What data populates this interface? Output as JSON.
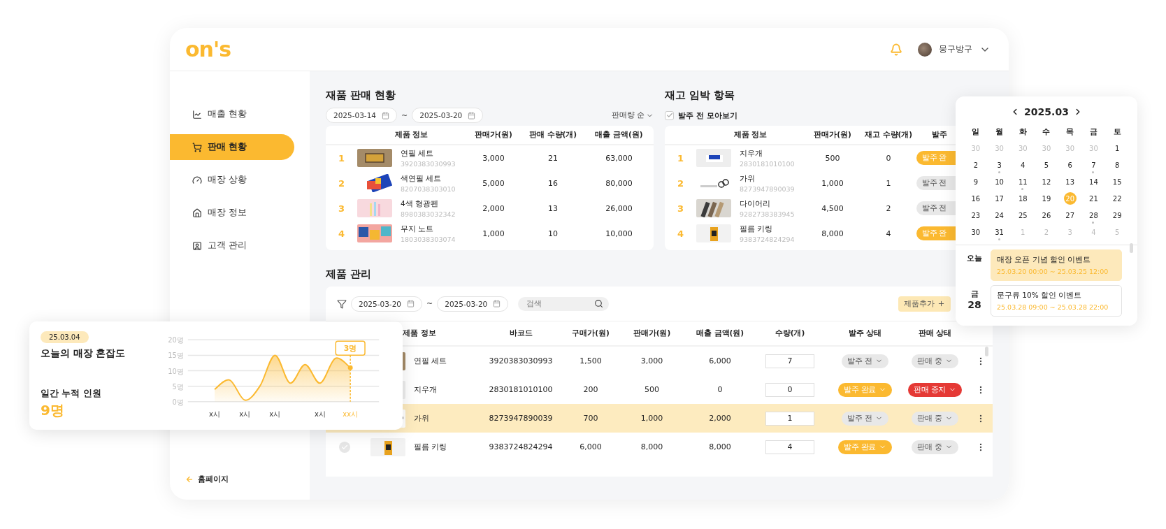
{
  "header": {
    "logo": "on's",
    "user_name": "뭉구방구"
  },
  "sidebar": {
    "items": [
      {
        "label": "매출 현황",
        "selected": false
      },
      {
        "label": "판매 현황",
        "selected": true
      },
      {
        "label": "매장 상황",
        "selected": false
      },
      {
        "label": "매장 정보",
        "selected": false
      },
      {
        "label": "고객 관리",
        "selected": false
      }
    ],
    "home_link": "홈페이지"
  },
  "sales": {
    "title": "재품 판매 현황",
    "date_from": "2025-03-14",
    "separator": "~",
    "date_to": "2025-03-20",
    "sort": "판매량 순",
    "columns": [
      "제품 정보",
      "판매가(원)",
      "판매 수량(개)",
      "매출 금액(원)"
    ],
    "rows": [
      {
        "rank": "1",
        "name": "연필 세트",
        "barcode": "3920383030993",
        "price": "3,000",
        "quantity": "21",
        "revenue": "63,000"
      },
      {
        "rank": "2",
        "name": "색연필 세트",
        "barcode": "8207038303010",
        "price": "5,000",
        "quantity": "16",
        "revenue": "80,000"
      },
      {
        "rank": "3",
        "name": "4색 형광펜",
        "barcode": "8980383032342",
        "price": "2,000",
        "quantity": "13",
        "revenue": "26,000"
      },
      {
        "rank": "4",
        "name": "무지 노트",
        "barcode": "1803038303074",
        "price": "1,000",
        "quantity": "10",
        "revenue": "10,000"
      }
    ]
  },
  "stock": {
    "title": "재고 임박 항목",
    "filter_label": "발주 전 모아보기",
    "filter_checked": true,
    "columns": [
      "제품 정보",
      "판매가(원)",
      "재고 수량(개)",
      "발주"
    ],
    "rows": [
      {
        "rank": "1",
        "name": "지우개",
        "barcode": "2830181010100",
        "price": "500",
        "stock": "0",
        "status": {
          "label": "발주 완",
          "color": "#fbb930"
        }
      },
      {
        "rank": "2",
        "name": "가위",
        "barcode": "8273947890039",
        "price": "1,000",
        "stock": "1",
        "status": {
          "label": "발주 전",
          "color": "#e8e8e8"
        }
      },
      {
        "rank": "3",
        "name": "다이어리",
        "barcode": "9282738383945",
        "price": "4,500",
        "stock": "2",
        "status": {
          "label": "발주 전",
          "color": "#e8e8e8"
        }
      },
      {
        "rank": "4",
        "name": "필름 키링",
        "barcode": "9383724824294",
        "price": "8,000",
        "stock": "4",
        "status": {
          "label": "발주 완",
          "color": "#fbb930"
        }
      }
    ]
  },
  "products": {
    "title": "제품 관리",
    "date_from": "2025-03-20",
    "separator": "~",
    "date_to": "2025-03-20",
    "search_placeholder": "검색",
    "add_button": "제품추가",
    "columns": [
      "제품 정보",
      "바코드",
      "구매가(원)",
      "판매가(원)",
      "매출 금액(원)",
      "수량(개)",
      "발주 상태",
      "판매 상태"
    ],
    "rows": [
      {
        "selected": false,
        "name": "연필 세트",
        "barcode": "3920383030993",
        "cost": "1,500",
        "price": "3,000",
        "revenue": "6,000",
        "quantity": "7",
        "order_status": {
          "label": "발주 전",
          "color": "#e8e8e8"
        },
        "sale_status": {
          "label": "판매 중",
          "color": "#e8e8e8"
        }
      },
      {
        "selected": false,
        "name": "지우개",
        "barcode": "2830181010100",
        "cost": "200",
        "price": "500",
        "revenue": "0",
        "quantity": "0",
        "order_status": {
          "label": "발주 완료",
          "color": "#fbb930"
        },
        "sale_status": {
          "label": "판매 중지",
          "color": "#e53935"
        }
      },
      {
        "selected": true,
        "name": "가위",
        "barcode": "8273947890039",
        "cost": "700",
        "price": "1,000",
        "revenue": "2,000",
        "quantity": "1",
        "order_status": {
          "label": "발주 전",
          "color": "#e8e8e8"
        },
        "sale_status": {
          "label": "판매 중",
          "color": "#e8e8e8"
        }
      },
      {
        "selected": false,
        "name": "필름 키링",
        "barcode": "9383724824294",
        "cost": "6,000",
        "price": "8,000",
        "revenue": "8,000",
        "quantity": "4",
        "order_status": {
          "label": "발주 완료",
          "color": "#fbb930"
        },
        "sale_status": {
          "label": "판매 중",
          "color": "#e8e8e8"
        }
      }
    ]
  },
  "calendar": {
    "month": "2025.03",
    "weekdays": [
      "일",
      "월",
      "화",
      "수",
      "목",
      "금",
      "토"
    ],
    "days": [
      {
        "day": "30",
        "muted": true,
        "has_event": false,
        "selected": false
      },
      {
        "day": "30",
        "muted": true,
        "has_event": false,
        "selected": false
      },
      {
        "day": "30",
        "muted": true,
        "has_event": false,
        "selected": false
      },
      {
        "day": "30",
        "muted": true,
        "has_event": false,
        "selected": false
      },
      {
        "day": "30",
        "muted": true,
        "has_event": false,
        "selected": false
      },
      {
        "day": "30",
        "muted": true,
        "has_event": false,
        "selected": false
      },
      {
        "day": "1",
        "muted": false,
        "has_event": false,
        "selected": false
      },
      {
        "day": "2",
        "muted": false,
        "has_event": false,
        "selected": false
      },
      {
        "day": "3",
        "muted": false,
        "has_event": true,
        "selected": false
      },
      {
        "day": "4",
        "muted": false,
        "has_event": false,
        "selected": false
      },
      {
        "day": "5",
        "muted": false,
        "has_event": false,
        "selected": false
      },
      {
        "day": "6",
        "muted": false,
        "has_event": false,
        "selected": false
      },
      {
        "day": "7",
        "muted": false,
        "has_event": true,
        "selected": false
      },
      {
        "day": "8",
        "muted": false,
        "has_event": false,
        "selected": false
      },
      {
        "day": "9",
        "muted": false,
        "has_event": false,
        "selected": false
      },
      {
        "day": "10",
        "muted": false,
        "has_event": false,
        "selected": false
      },
      {
        "day": "11",
        "muted": false,
        "has_event": true,
        "selected": false
      },
      {
        "day": "12",
        "muted": false,
        "has_event": false,
        "selected": false
      },
      {
        "day": "13",
        "muted": false,
        "has_event": false,
        "selected": false
      },
      {
        "day": "14",
        "muted": false,
        "has_event": false,
        "selected": false
      },
      {
        "day": "15",
        "muted": false,
        "has_event": false,
        "selected": false
      },
      {
        "day": "16",
        "muted": false,
        "has_event": false,
        "selected": false
      },
      {
        "day": "17",
        "muted": false,
        "has_event": false,
        "selected": false
      },
      {
        "day": "18",
        "muted": false,
        "has_event": false,
        "selected": false
      },
      {
        "day": "19",
        "muted": false,
        "has_event": false,
        "selected": false
      },
      {
        "day": "20",
        "muted": false,
        "has_event": false,
        "selected": true
      },
      {
        "day": "21",
        "muted": false,
        "has_event": false,
        "selected": false
      },
      {
        "day": "22",
        "muted": false,
        "has_event": false,
        "selected": false
      },
      {
        "day": "23",
        "muted": false,
        "has_event": false,
        "selected": false
      },
      {
        "day": "24",
        "muted": false,
        "has_event": false,
        "selected": false
      },
      {
        "day": "25",
        "muted": false,
        "has_event": false,
        "selected": false
      },
      {
        "day": "26",
        "muted": false,
        "has_event": false,
        "selected": false
      },
      {
        "day": "27",
        "muted": false,
        "has_event": false,
        "selected": false
      },
      {
        "day": "28",
        "muted": false,
        "has_event": true,
        "selected": false
      },
      {
        "day": "29",
        "muted": false,
        "has_event": false,
        "selected": false
      },
      {
        "day": "30",
        "muted": false,
        "has_event": false,
        "selected": false
      },
      {
        "day": "31",
        "muted": false,
        "has_event": true,
        "selected": false
      },
      {
        "day": "1",
        "muted": true,
        "has_event": false,
        "selected": false
      },
      {
        "day": "2",
        "muted": true,
        "has_event": false,
        "selected": false
      },
      {
        "day": "3",
        "muted": true,
        "has_event": false,
        "selected": false
      },
      {
        "day": "4",
        "muted": true,
        "has_event": false,
        "selected": false
      },
      {
        "day": "5",
        "muted": true,
        "has_event": false,
        "selected": false
      }
    ],
    "agenda": [
      {
        "weekday": "오늘",
        "event": {
          "title": "매장 오픈 기념 할인 이벤트",
          "time": "25.03.20 00:00 ~ 25.03.25 12:00",
          "highlighted": true
        }
      },
      {
        "weekday": "금",
        "day": "28",
        "event": {
          "title": "문구류 10% 할인 이벤트",
          "time": "25.03.28 09:00 ~ 25.03.28 22:00",
          "highlighted": false
        }
      }
    ]
  },
  "crowd": {
    "date": "25.03.04",
    "title": "오늘의 매장 혼잡도",
    "total_label": "일간 누적 인원",
    "total": "9명",
    "chart_data": {
      "type": "area",
      "ylim": [
        0,
        20
      ],
      "yticks": [
        {
          "value": 0,
          "label": "0명"
        },
        {
          "value": 5,
          "label": "5명"
        },
        {
          "value": 10,
          "label": "10명"
        },
        {
          "value": 15,
          "label": "15명"
        },
        {
          "value": 20,
          "label": "20명"
        }
      ],
      "categories": [
        "x시",
        null,
        "x시",
        null,
        "x시",
        null,
        null,
        "x시",
        null,
        "xx시"
      ],
      "series": [
        {
          "color": "#fbb930",
          "values": [
            4,
            7,
            0.5,
            5,
            15,
            6,
            12,
            6,
            14,
            11
          ]
        }
      ],
      "grid": true,
      "annotations": [
        {
          "x": "xx시",
          "y": 11,
          "text": "3명"
        }
      ]
    }
  }
}
